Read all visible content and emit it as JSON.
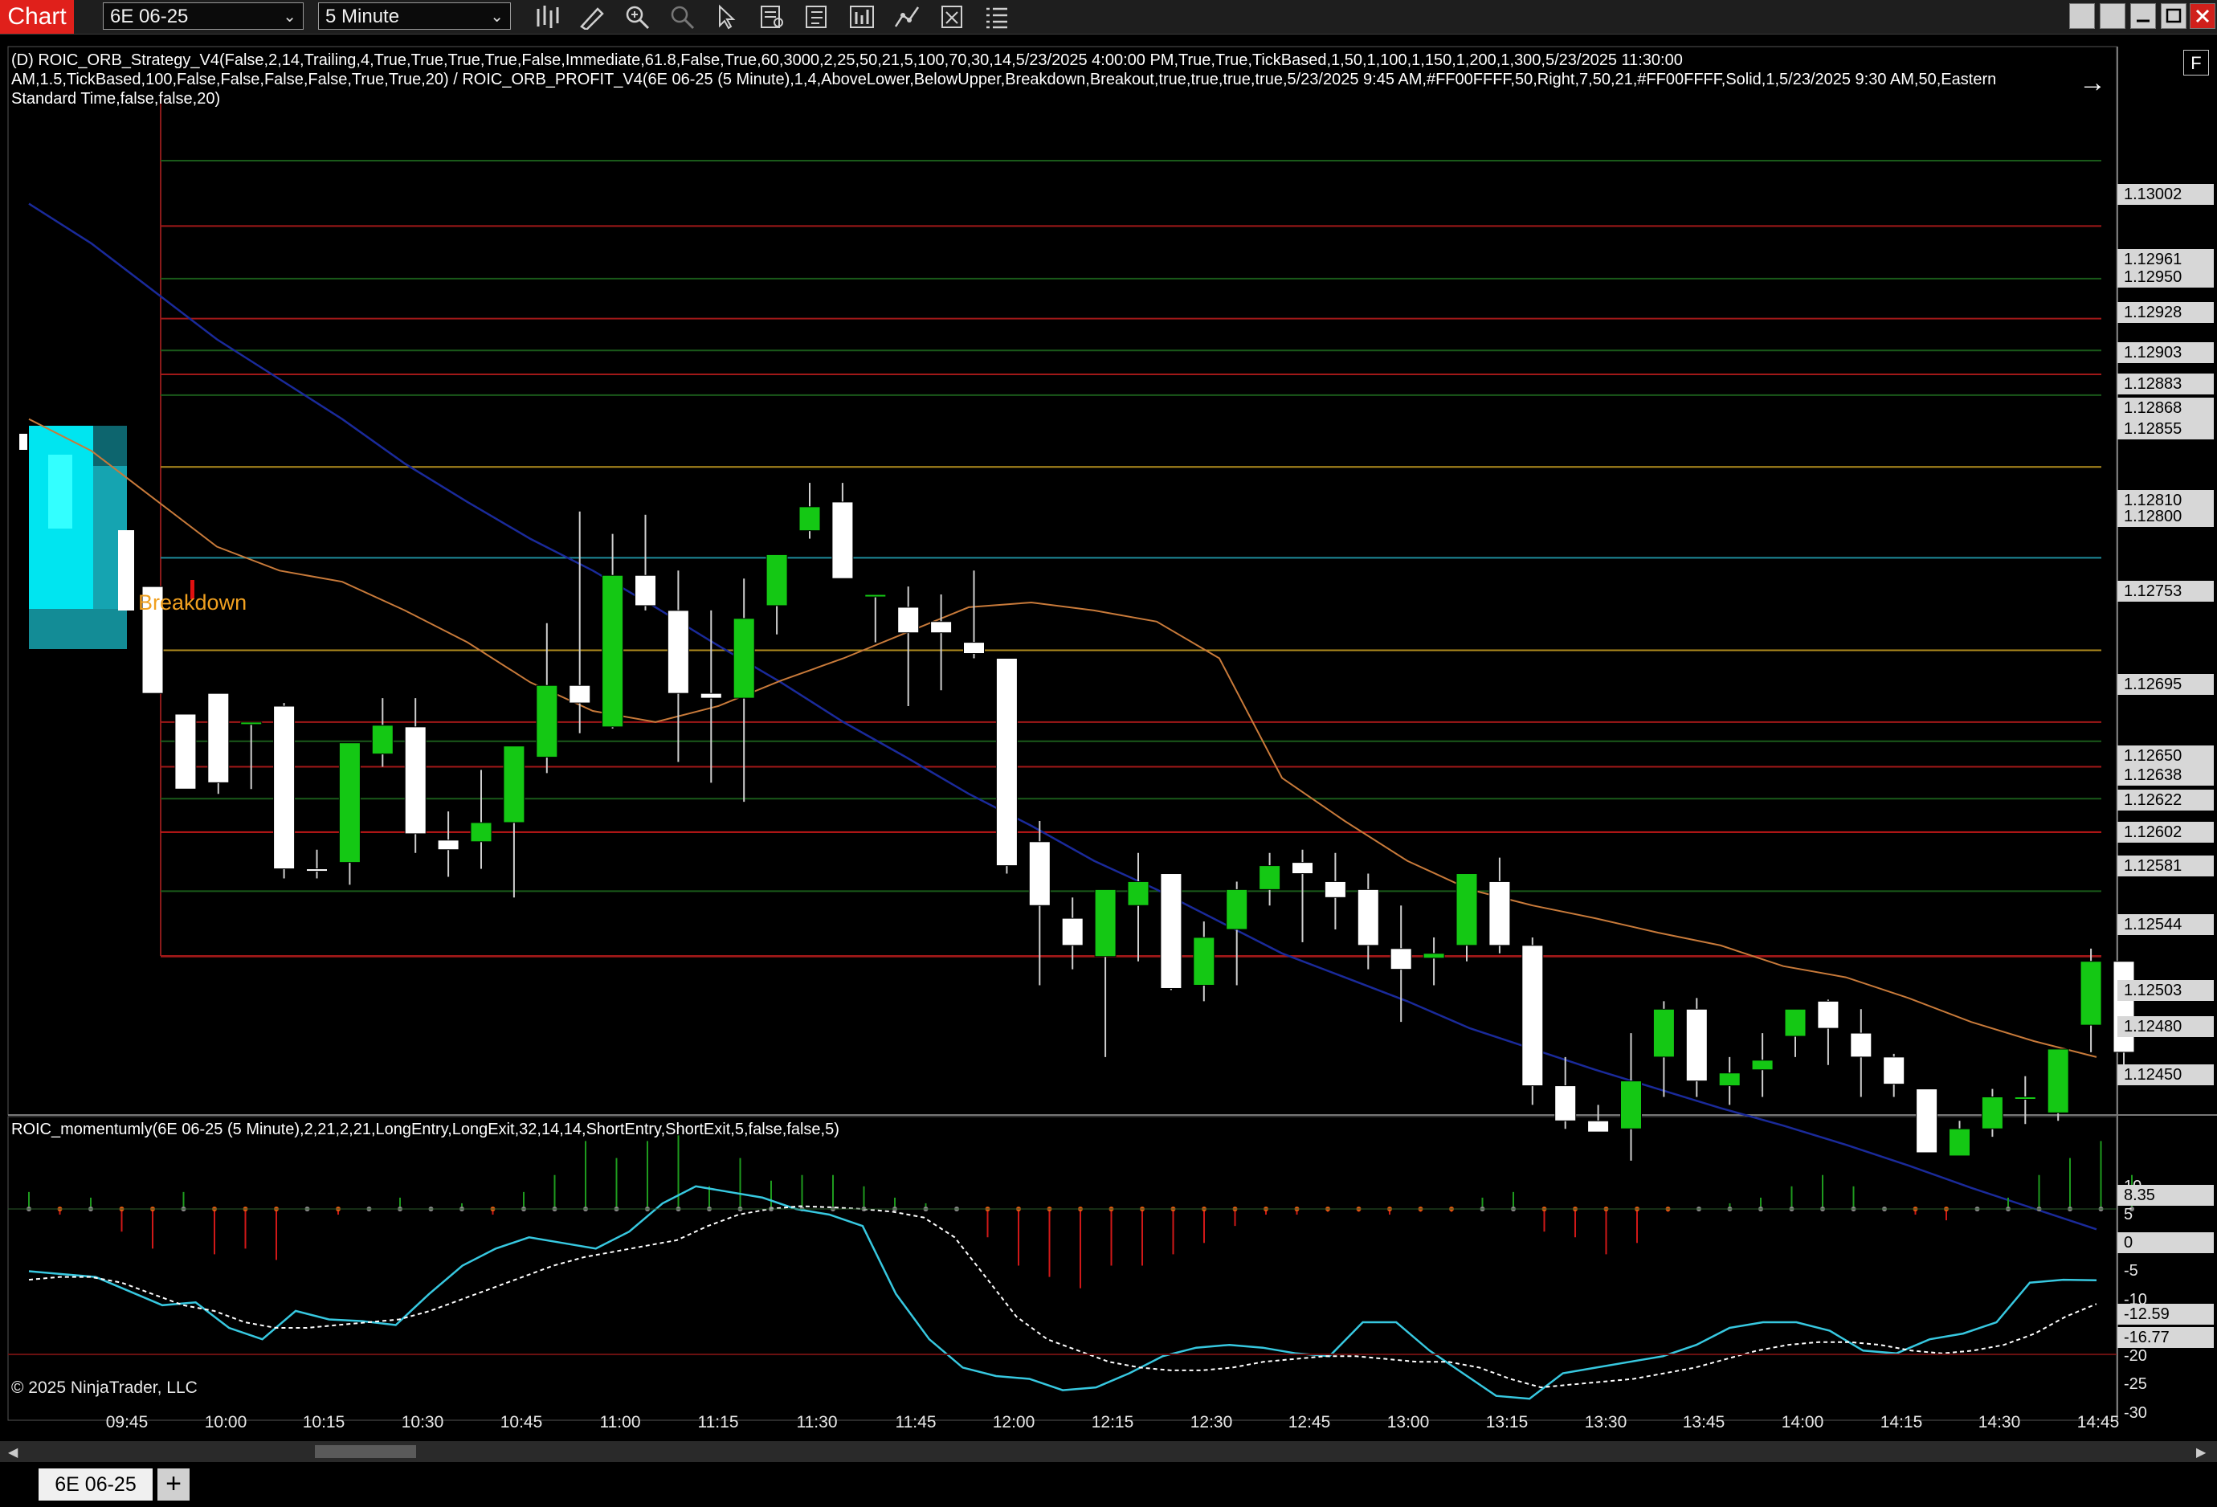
{
  "toolbar": {
    "app_tab": "Chart",
    "instrument": "6E 06-25",
    "interval": "5 Minute",
    "icons": [
      "bar-type-icon",
      "draw-tools-icon",
      "zoom-in-icon",
      "zoom-out-icon",
      "pointer-icon",
      "data-box-icon",
      "properties-icon",
      "indicators-icon",
      "strategies-icon",
      "templates-icon",
      "list-icon"
    ],
    "window_buttons": [
      "tile-icon",
      "tile-icon",
      "minimize-icon",
      "maximize-icon",
      "close-icon"
    ]
  },
  "main_panel": {
    "indicator_line_1": "(D) ROIC_ORB_Strategy_V4(False,2,14,Trailing,4,True,True,True,True,False,Immediate,61.8,False,True,60,3000,2,25,50,21,5,100,70,30,14,5/23/2025 4:00:00 PM,True,True,TickBased,1,50,1,100,1,150,1,200,1,300,5/23/2025 11:30:00",
    "indicator_line_2": "AM,1.5,TickBased,100,False,False,False,False,True,True,20) / ROIC_ORB_PROFIT_V4(6E 06-25 (5 Minute),1,4,AboveLower,BelowUpper,Breakdown,Breakout,true,true,true,true,5/23/2025 9:45 AM,#FF00FFFF,50,Right,7,50,21,#FF00FFFF,Solid,1,5/23/2025 9:30 AM,50,Eastern",
    "indicator_line_3": "Standard Time,false,false,20)",
    "breakdown_label": "Breakdown",
    "f_button": "F",
    "price_labels": [
      "1.13002",
      "1.12961",
      "1.12950",
      "1.12928",
      "1.12903",
      "1.12883",
      "1.12868",
      "1.12855",
      "1.12810",
      "1.12800",
      "1.12753",
      "1.12695",
      "1.12650",
      "1.12638",
      "1.12622",
      "1.12602",
      "1.12581",
      "1.12544",
      "1.12503",
      "1.12480",
      "1.12450"
    ]
  },
  "osc_panel": {
    "title": "ROIC_momentumly(6E 06-25 (5 Minute),2,21,2,21,LongEntry,LongExit,32,14,14,ShortEntry,ShortExit,5,false,false,5)",
    "axis_labels": [
      "10",
      "8.35",
      "5",
      "0",
      "-5",
      "-10",
      "-12.59",
      "-16.77",
      "-20",
      "-25",
      "-30"
    ]
  },
  "time_axis": [
    "09:45",
    "10:00",
    "10:15",
    "10:30",
    "10:45",
    "11:00",
    "11:15",
    "11:30",
    "11:45",
    "12:00",
    "12:15",
    "12:30",
    "12:45",
    "13:00",
    "13:15",
    "13:30",
    "13:45",
    "14:00",
    "14:15",
    "14:30",
    "14:45"
  ],
  "copyright": "© 2025 NinjaTrader, LLC",
  "bottom_tabs": {
    "instrument_tab": "6E 06-25",
    "add_tab": "+"
  },
  "colors": {
    "bull": "#14c814",
    "bear": "#ffffff",
    "ema_fast": "#c87a3a",
    "ema_slow": "#1a2a9a",
    "osc_fast": "#37c8e0",
    "osc_slow": "#ffffff",
    "app_red": "#e0201b"
  },
  "chart_data": {
    "type": "candlestick",
    "instrument": "6E 06-25",
    "interval": "5 Minute",
    "ylim": [
      1.1242,
      1.1305
    ],
    "candles": [
      {
        "o": 1.12735,
        "h": 1.12735,
        "l": 1.12668,
        "c": 1.12668
      },
      {
        "o": 1.12655,
        "h": 1.12655,
        "l": 1.1261,
        "c": 1.12608
      },
      {
        "o": 1.12668,
        "h": 1.12668,
        "l": 1.12605,
        "c": 1.12612
      },
      {
        "o": 1.1265,
        "h": 1.1265,
        "l": 1.12608,
        "c": 1.1265
      },
      {
        "o": 1.1266,
        "h": 1.12662,
        "l": 1.12552,
        "c": 1.12558
      },
      {
        "o": 1.12558,
        "h": 1.1257,
        "l": 1.12552,
        "c": 1.12557
      },
      {
        "o": 1.12562,
        "h": 1.1263,
        "l": 1.12548,
        "c": 1.12637
      },
      {
        "o": 1.1263,
        "h": 1.12665,
        "l": 1.12622,
        "c": 1.12648
      },
      {
        "o": 1.12647,
        "h": 1.12665,
        "l": 1.12568,
        "c": 1.1258
      },
      {
        "o": 1.12576,
        "h": 1.12594,
        "l": 1.12553,
        "c": 1.1257
      },
      {
        "o": 1.12575,
        "h": 1.1262,
        "l": 1.12558,
        "c": 1.12587
      },
      {
        "o": 1.12587,
        "h": 1.12625,
        "l": 1.1254,
        "c": 1.12635
      },
      {
        "o": 1.12628,
        "h": 1.12712,
        "l": 1.12618,
        "c": 1.12673
      },
      {
        "o": 1.12673,
        "h": 1.12782,
        "l": 1.12643,
        "c": 1.12662
      },
      {
        "o": 1.12647,
        "h": 1.12768,
        "l": 1.12646,
        "c": 1.12742
      },
      {
        "o": 1.12742,
        "h": 1.1278,
        "l": 1.1272,
        "c": 1.12723
      },
      {
        "o": 1.1272,
        "h": 1.12745,
        "l": 1.12625,
        "c": 1.12668
      },
      {
        "o": 1.12668,
        "h": 1.1272,
        "l": 1.12612,
        "c": 1.12665
      },
      {
        "o": 1.12665,
        "h": 1.1274,
        "l": 1.126,
        "c": 1.12715
      },
      {
        "o": 1.12723,
        "h": 1.12755,
        "l": 1.12705,
        "c": 1.12755
      },
      {
        "o": 1.1277,
        "h": 1.128,
        "l": 1.12765,
        "c": 1.12785
      },
      {
        "o": 1.12788,
        "h": 1.128,
        "l": 1.1274,
        "c": 1.1274
      },
      {
        "o": 1.1273,
        "h": 1.1273,
        "l": 1.127,
        "c": 1.1273
      },
      {
        "o": 1.12722,
        "h": 1.12735,
        "l": 1.1266,
        "c": 1.12706
      },
      {
        "o": 1.12713,
        "h": 1.1273,
        "l": 1.1267,
        "c": 1.12706
      },
      {
        "o": 1.127,
        "h": 1.12745,
        "l": 1.1269,
        "c": 1.12693
      },
      {
        "o": 1.1269,
        "h": 1.1269,
        "l": 1.12555,
        "c": 1.1256
      },
      {
        "o": 1.12575,
        "h": 1.12588,
        "l": 1.12485,
        "c": 1.12535
      },
      {
        "o": 1.12527,
        "h": 1.1254,
        "l": 1.12495,
        "c": 1.1251
      },
      {
        "o": 1.12503,
        "h": 1.12545,
        "l": 1.1244,
        "c": 1.12545
      },
      {
        "o": 1.12535,
        "h": 1.12568,
        "l": 1.125,
        "c": 1.1255
      },
      {
        "o": 1.12555,
        "h": 1.12555,
        "l": 1.12482,
        "c": 1.12483
      },
      {
        "o": 1.12485,
        "h": 1.12525,
        "l": 1.12475,
        "c": 1.12515
      },
      {
        "o": 1.1252,
        "h": 1.1255,
        "l": 1.12485,
        "c": 1.12545
      },
      {
        "o": 1.12545,
        "h": 1.12568,
        "l": 1.12535,
        "c": 1.1256
      },
      {
        "o": 1.12562,
        "h": 1.1257,
        "l": 1.12512,
        "c": 1.12555
      },
      {
        "o": 1.1255,
        "h": 1.12568,
        "l": 1.1252,
        "c": 1.1254
      },
      {
        "o": 1.12545,
        "h": 1.12555,
        "l": 1.12495,
        "c": 1.1251
      },
      {
        "o": 1.12508,
        "h": 1.12535,
        "l": 1.12462,
        "c": 1.12495
      },
      {
        "o": 1.12502,
        "h": 1.12515,
        "l": 1.12485,
        "c": 1.12505
      },
      {
        "o": 1.1251,
        "h": 1.12555,
        "l": 1.125,
        "c": 1.12555
      },
      {
        "o": 1.1255,
        "h": 1.12565,
        "l": 1.12505,
        "c": 1.1251
      },
      {
        "o": 1.1251,
        "h": 1.12515,
        "l": 1.1241,
        "c": 1.12422
      },
      {
        "o": 1.12422,
        "h": 1.1244,
        "l": 1.12395,
        "c": 1.124
      },
      {
        "o": 1.124,
        "h": 1.1241,
        "l": 1.12395,
        "c": 1.12393
      },
      {
        "o": 1.12395,
        "h": 1.12455,
        "l": 1.12375,
        "c": 1.12425
      },
      {
        "o": 1.1244,
        "h": 1.12475,
        "l": 1.12415,
        "c": 1.1247
      },
      {
        "o": 1.1247,
        "h": 1.12477,
        "l": 1.12415,
        "c": 1.12425
      },
      {
        "o": 1.12422,
        "h": 1.1244,
        "l": 1.1241,
        "c": 1.1243
      },
      {
        "o": 1.12432,
        "h": 1.12455,
        "l": 1.12415,
        "c": 1.12438
      },
      {
        "o": 1.12453,
        "h": 1.1247,
        "l": 1.1244,
        "c": 1.1247
      },
      {
        "o": 1.12475,
        "h": 1.12476,
        "l": 1.12435,
        "c": 1.12458
      },
      {
        "o": 1.12455,
        "h": 1.1247,
        "l": 1.12415,
        "c": 1.1244
      },
      {
        "o": 1.1244,
        "h": 1.12442,
        "l": 1.12415,
        "c": 1.12423
      },
      {
        "o": 1.1242,
        "h": 1.1242,
        "l": 1.1238,
        "c": 1.1238
      },
      {
        "o": 1.12378,
        "h": 1.124,
        "l": 1.12378,
        "c": 1.12395
      },
      {
        "o": 1.12395,
        "h": 1.1242,
        "l": 1.1239,
        "c": 1.12415
      },
      {
        "o": 1.12415,
        "h": 1.12428,
        "l": 1.12398,
        "c": 1.12415
      },
      {
        "o": 1.12405,
        "h": 1.12445,
        "l": 1.124,
        "c": 1.12445
      },
      {
        "o": 1.1246,
        "h": 1.12508,
        "l": 1.12443,
        "c": 1.125
      },
      {
        "o": 1.125,
        "h": 1.125,
        "l": 1.12428,
        "c": 1.12443
      }
    ],
    "ema_fast": [
      1.1284,
      1.1282,
      1.1279,
      1.1276,
      1.12745,
      1.12738,
      1.1272,
      1.127,
      1.12675,
      1.12657,
      1.1265,
      1.1266,
      1.12676,
      1.1269,
      1.12706,
      1.12722,
      1.12725,
      1.1272,
      1.12713,
      1.1269,
      1.12615,
      1.12588,
      1.12563,
      1.12545,
      1.12535,
      1.12527,
      1.12518,
      1.1251,
      1.12497,
      1.1249,
      1.12477,
      1.12462,
      1.1245,
      1.1244
    ],
    "ema_slow": [
      1.12975,
      1.1295,
      1.1292,
      1.1289,
      1.12865,
      1.1284,
      1.12812,
      1.12788,
      1.12765,
      1.12745,
      1.12722,
      1.12698,
      1.12675,
      1.1265,
      1.12628,
      1.12605,
      1.12585,
      1.12563,
      1.12545,
      1.12525,
      1.12505,
      1.1249,
      1.12475,
      1.12458,
      1.12445,
      1.12432,
      1.1242,
      1.12408,
      1.12397,
      1.12385,
      1.12372,
      1.12358,
      1.12345,
      1.12332
    ],
    "hlines": [
      {
        "price": 1.13002,
        "color": "#1a5a1a"
      },
      {
        "price": 1.12961,
        "color": "#a01818"
      },
      {
        "price": 1.12928,
        "color": "#1a5a1a"
      },
      {
        "price": 1.12903,
        "color": "#a01818"
      },
      {
        "price": 1.12883,
        "color": "#1a5a1a"
      },
      {
        "price": 1.12868,
        "color": "#a01818"
      },
      {
        "price": 1.12855,
        "color": "#1a5a1a"
      },
      {
        "price": 1.1281,
        "color": "#b08c1e"
      },
      {
        "price": 1.12753,
        "color": "#1e8c9c"
      },
      {
        "price": 1.12695,
        "color": "#b08c1e"
      },
      {
        "price": 1.1265,
        "color": "#a01818"
      },
      {
        "price": 1.12638,
        "color": "#1a5a1a"
      },
      {
        "price": 1.12622,
        "color": "#a01818"
      },
      {
        "price": 1.12602,
        "color": "#1a5a1a"
      },
      {
        "price": 1.12581,
        "color": "#c01818"
      },
      {
        "price": 1.12544,
        "color": "#1a5a1a"
      },
      {
        "price": 1.12503,
        "color": "#a01818"
      }
    ],
    "osc_ylim": [
      -32,
      12
    ],
    "osc_fast": [
      -11,
      -11.5,
      -12,
      -14.5,
      -17,
      -16.5,
      -21,
      -23,
      -18,
      -19.5,
      -19.8,
      -20.5,
      -15,
      -10,
      -7,
      -5,
      -6,
      -7,
      -4,
      1,
      4,
      3,
      2,
      0,
      -1,
      -3,
      -15,
      -23,
      -28,
      -29.5,
      -30,
      -32,
      -31.5,
      -29,
      -26,
      -24.5,
      -24,
      -24.5,
      -25.5,
      -26,
      -20,
      -20,
      -25,
      -29,
      -33,
      -33.5,
      -29,
      -28,
      -27,
      -26,
      -24,
      -21,
      -20,
      -20,
      -21.5,
      -25,
      -25.5,
      -23,
      -22,
      -20,
      -13,
      -12.5,
      -12.59
    ],
    "osc_slow": [
      -12.5,
      -12,
      -12,
      -13,
      -15,
      -17,
      -18,
      -20,
      -21,
      -21,
      -20.5,
      -20,
      -19.5,
      -18,
      -16,
      -14,
      -12,
      -10,
      -8.5,
      -7.5,
      -6.5,
      -5.5,
      -3,
      -1,
      0,
      0.5,
      0.3,
      0,
      -0.5,
      -1.5,
      -5,
      -12,
      -19,
      -23,
      -25,
      -27,
      -28,
      -28.5,
      -28.5,
      -28,
      -27,
      -26.5,
      -26,
      -26,
      -26.5,
      -27,
      -27,
      -28,
      -30,
      -31.5,
      -31,
      -30.5,
      -30,
      -29,
      -28,
      -26.5,
      -25,
      -24,
      -23.5,
      -23.5,
      -24,
      -25,
      -25.5,
      -25,
      -24,
      -22,
      -19,
      -16.77
    ],
    "osc_bars": [
      3,
      -1,
      2,
      -4,
      -7,
      3,
      -8,
      -7,
      -9,
      0,
      -1,
      0,
      2,
      0,
      1,
      -1,
      3,
      6,
      12,
      9,
      12,
      13,
      4,
      9,
      5,
      6,
      6,
      4,
      2,
      1,
      0,
      -5,
      -10,
      -12,
      -14,
      -10,
      -10,
      -8,
      -6,
      -3,
      -1,
      -1,
      -0.5,
      -0.5,
      -1,
      -0.5,
      -0.5,
      2,
      3,
      -4,
      -5,
      -8,
      -6,
      -0.5,
      0,
      1,
      2,
      4,
      6,
      4,
      0,
      -1,
      -2,
      0,
      2,
      6,
      9,
      12,
      6
    ]
  }
}
